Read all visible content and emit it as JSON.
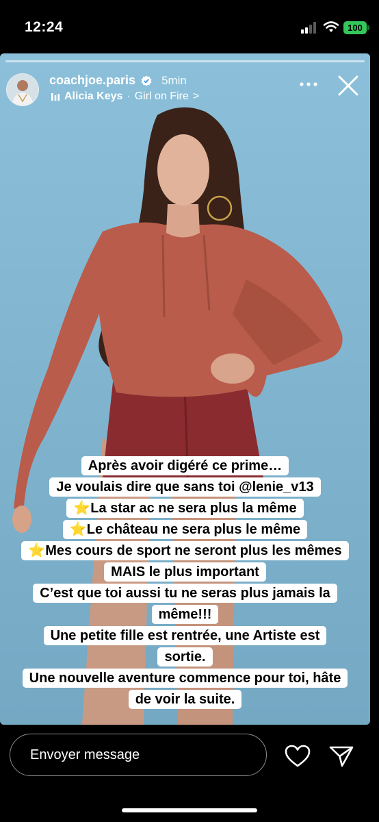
{
  "status_bar": {
    "time": "12:24",
    "battery": "100",
    "battery_color": "#34c759"
  },
  "story": {
    "username": "coachjoe.paris",
    "verified_icon": "verified-badge-icon",
    "timestamp": "5min",
    "music": {
      "icon": "equalizer-icon",
      "artist": "Alicia Keys",
      "separator": "·",
      "song": "Girl on Fire",
      "chevron": ">"
    },
    "more_icon": "more-dots-icon",
    "close_icon": "close-icon",
    "background_color": "#7fb3cf",
    "caption_lines": [
      "Après avoir digéré ce prime…",
      "Je voulais dire que sans toi @lenie_v13",
      "⭐La star ac ne sera plus la même",
      "⭐Le château ne sera plus le même",
      "⭐Mes cours de sport ne seront plus les mêmes",
      "MAIS le plus important",
      "C’est que toi aussi tu ne seras plus jamais la",
      "même!!!",
      "Une petite fille est rentrée, une Artiste est",
      "sortie.",
      "Une nouvelle aventure commence pour toi, hâte",
      "de voir la suite."
    ]
  },
  "footer": {
    "message_placeholder": "Envoyer message",
    "heart_icon": "heart-icon",
    "send_icon": "send-icon"
  }
}
